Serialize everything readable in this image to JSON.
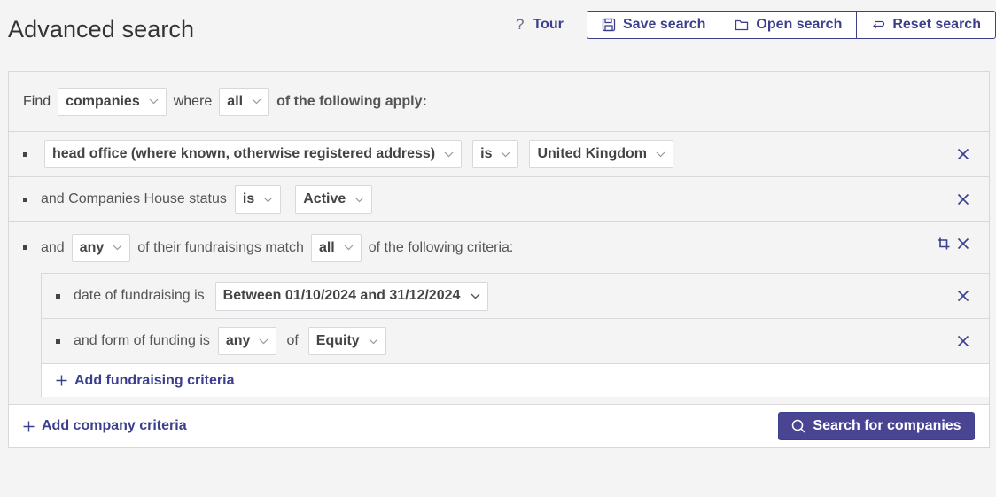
{
  "header": {
    "title": "Advanced search",
    "tour_label": "Tour",
    "tour_icon": "?",
    "save_label": "Save search",
    "open_label": "Open search",
    "reset_label": "Reset search"
  },
  "find_row": {
    "find": "Find",
    "entity": "companies",
    "where": "where",
    "quantifier": "all",
    "suffix": "of the following apply:"
  },
  "criteria": [
    {
      "field": "head office (where known, otherwise registered address)",
      "operator": "is",
      "value": "United Kingdom"
    },
    {
      "prefix": "and Companies House status",
      "operator": "is",
      "value": "Active"
    }
  ],
  "fundraising": {
    "and": "and",
    "quantifier": "any",
    "middle": "of their fundraisings match",
    "match": "all",
    "suffix": "of the following criteria:",
    "subcriteria": [
      {
        "label": "date of fundraising is",
        "value": "Between 01/10/2024 and 31/12/2024"
      },
      {
        "label": "and form of funding is",
        "quantifier": "any",
        "of": "of",
        "value": "Equity"
      }
    ],
    "add_label": "Add fundraising criteria"
  },
  "footer": {
    "add_company_label": "Add company criteria",
    "search_label": "Search for companies"
  },
  "colors": {
    "accent": "#3b3f8c",
    "button_bg": "#4a4593"
  }
}
